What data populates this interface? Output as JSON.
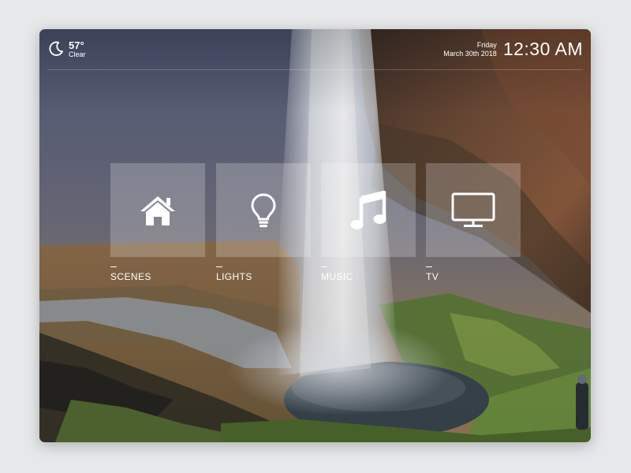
{
  "weather": {
    "temperature": "57°",
    "condition": "Clear",
    "icon": "moon-icon"
  },
  "clock": {
    "day": "Friday",
    "date": "March 30th 2018",
    "time": "12:30 AM"
  },
  "tiles": [
    {
      "label": "SCENES",
      "icon": "home-icon"
    },
    {
      "label": "LIGHTS",
      "icon": "lightbulb-icon"
    },
    {
      "label": "MUSIC",
      "icon": "music-note-icon"
    },
    {
      "label": "TV",
      "icon": "tv-icon"
    }
  ],
  "colors": {
    "text": "#ffffff",
    "tile_overlay": "rgba(255,255,255,0.22)",
    "page_background": "#e7e8ea"
  }
}
